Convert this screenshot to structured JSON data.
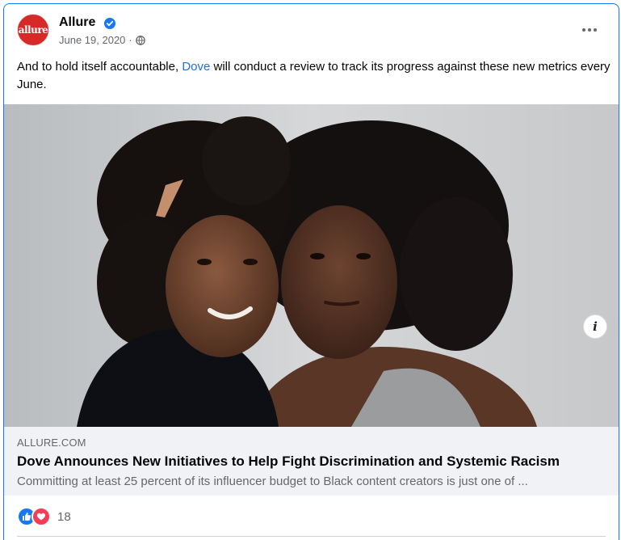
{
  "post": {
    "page_name": "Allure",
    "avatar_text": "allure",
    "date": "June 19, 2020",
    "separator": "·",
    "caption_before": "And to hold itself accountable, ",
    "caption_link": "Dove",
    "caption_after": " will conduct a review to track its progress against these new metrics every June."
  },
  "link_preview": {
    "domain": "ALLURE.COM",
    "headline": "Dove Announces New Initiatives to Help Fight Discrimination and Systemic Racism",
    "description": "Committing at least 25 percent of its influencer budget to Black content creators is just one of ...",
    "info_glyph": "i"
  },
  "reactions": {
    "count": "18",
    "types": [
      "like",
      "love"
    ]
  },
  "colors": {
    "accent": "#1877f2",
    "link": "#216fdb",
    "love": "#f33e58",
    "muted": "#65676b",
    "preview_bg": "#f0f2f5"
  },
  "icons": [
    "verified-badge-icon",
    "globe-icon",
    "more-options-icon",
    "info-icon",
    "like-reaction-icon",
    "love-reaction-icon"
  ]
}
